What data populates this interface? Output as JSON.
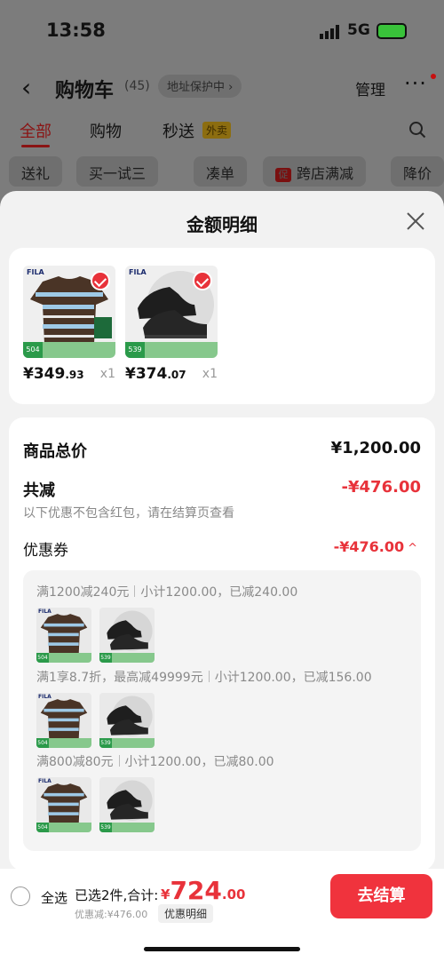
{
  "status": {
    "time": "13:58",
    "network": "5G"
  },
  "nav": {
    "back": "‹",
    "title": "购物车",
    "count": "(45)",
    "address": "地址保护中 ›",
    "manage": "管理",
    "more": "···"
  },
  "tabs": {
    "all": "全部",
    "shop": "购物",
    "flash": "秒送",
    "flash_badge": "外卖"
  },
  "chips": [
    "送礼",
    "买一试三",
    "凑单",
    "跨店满减",
    "降价"
  ],
  "chip_promo_icon": "促",
  "sheet": {
    "title": "金额明细",
    "products": [
      {
        "brand": "FILA",
        "tag": "504",
        "price_main": "¥349",
        "price_dec": ".93",
        "qty": "x1"
      },
      {
        "brand": "FILA",
        "tag": "539",
        "price_main": "¥374",
        "price_dec": ".07",
        "qty": "x1"
      }
    ],
    "summary": {
      "total_label": "商品总价",
      "total_value": "¥1,200.00",
      "reduce_label": "共减",
      "reduce_value": "-¥476.00",
      "hint": "以下优惠不包含红包，请在结算页查看",
      "coupon_label": "优惠券",
      "coupon_value": "-¥476.00",
      "coupon_caret": "^"
    },
    "discounts": [
      {
        "rule": "满1200减240元",
        "detail": "小计1200.00，已减240.00"
      },
      {
        "rule": "满1享8.7折，最高减49999元",
        "detail": "小计1200.00，已减156.00"
      },
      {
        "rule": "满800减80元",
        "detail": "小计1200.00，已减80.00"
      }
    ]
  },
  "bottom": {
    "select_all": "全选",
    "selected": "已选2件,合计:",
    "currency": "¥",
    "amount_int": "724",
    "amount_dec": ".00",
    "discount": "优惠减:¥476.00",
    "detail_button": "优惠明细",
    "checkout": "去结算"
  },
  "colors": {
    "accent": "#f0333d",
    "price_red": "#e8323a"
  }
}
